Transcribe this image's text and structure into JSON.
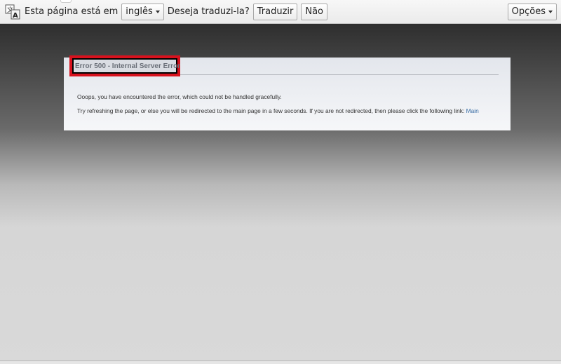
{
  "translate_bar": {
    "prompt_label": "Esta página está em",
    "language_selected": "inglês",
    "question_label": "Deseja traduzi-la?",
    "translate_button": "Traduzir",
    "no_button": "Não",
    "options_button": "Opções",
    "icon": "translate-icon"
  },
  "error_page": {
    "title": "Error 500 - Internal Server Error",
    "message1": "Ooops, you have encountered the error, which could not be handled gracefully.",
    "message2": "Try refreshing the page, or else you will be redirected to the main page in a few seconds. If you are not redirected, then please click the following link:",
    "main_link": "Main"
  },
  "colors": {
    "highlight_border": "#d8121e",
    "link": "#3a6ea5"
  }
}
